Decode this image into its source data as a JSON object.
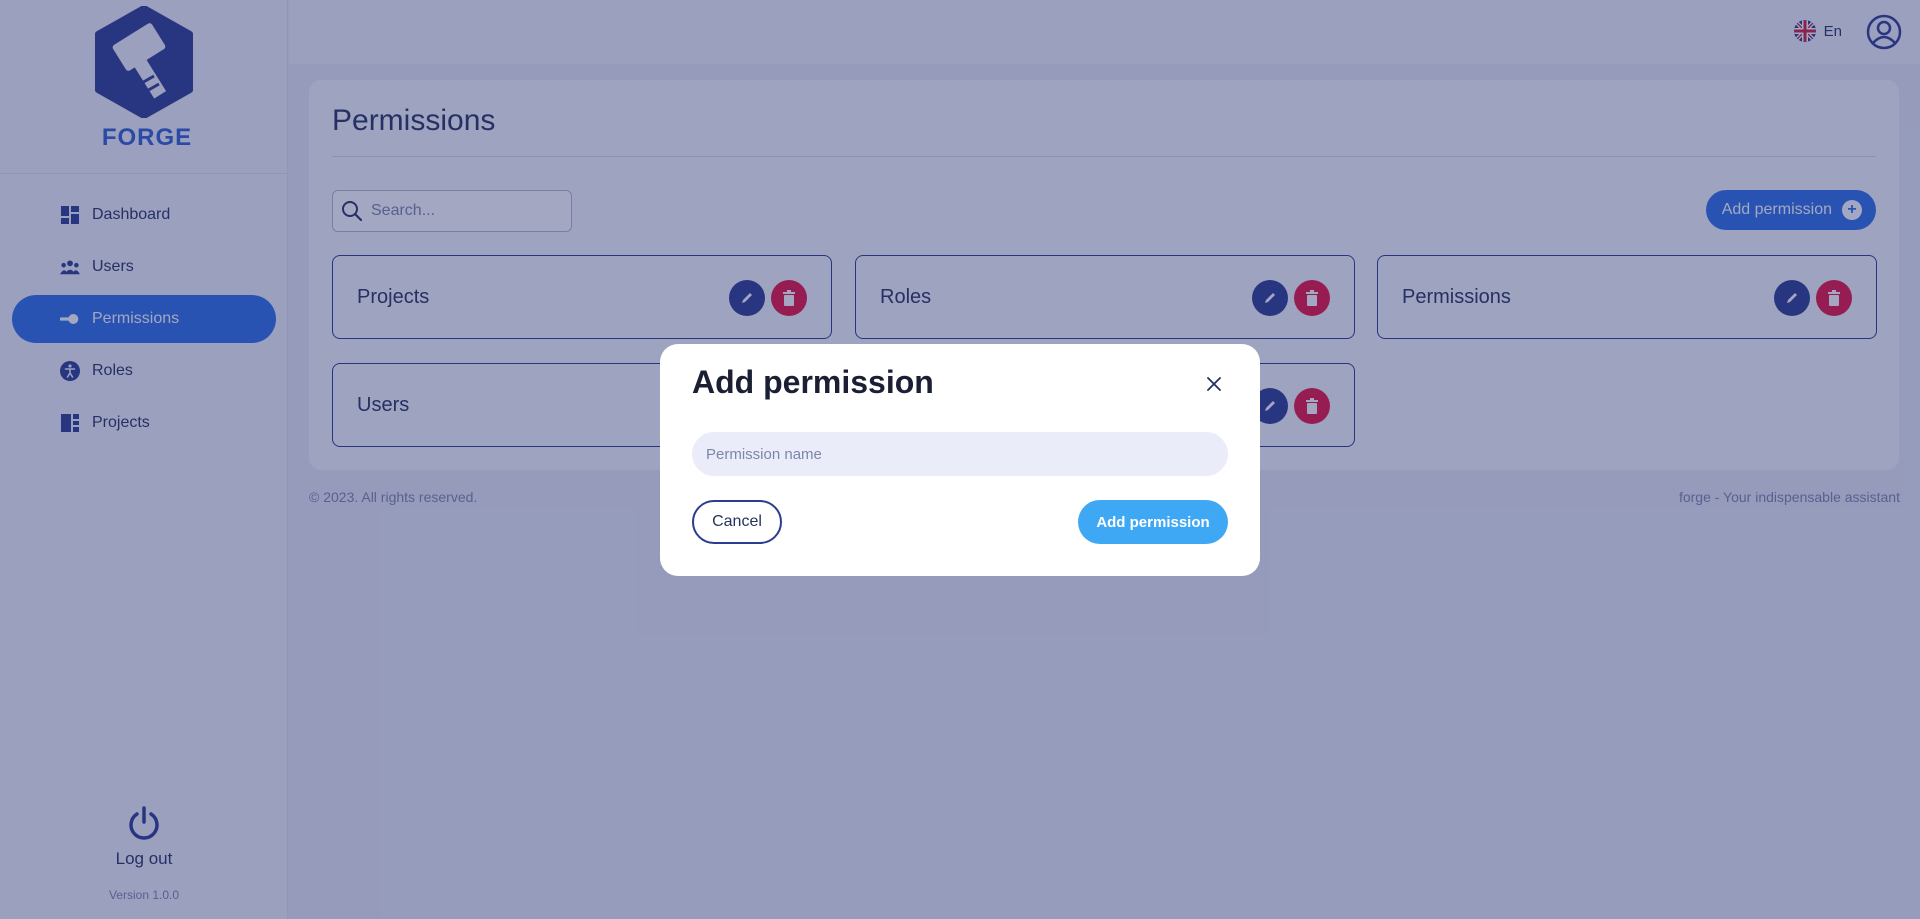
{
  "app": {
    "logo_text": "FORGE",
    "version": "Version 1.0.0",
    "logout_label": "Log out"
  },
  "sidebar": {
    "items": [
      {
        "label": "Dashboard",
        "icon": "dashboard-icon",
        "active": false
      },
      {
        "label": "Users",
        "icon": "users-icon",
        "active": false
      },
      {
        "label": "Permissions",
        "icon": "key-icon",
        "active": true
      },
      {
        "label": "Roles",
        "icon": "accessibility-icon",
        "active": false
      },
      {
        "label": "Projects",
        "icon": "projects-icon",
        "active": false
      }
    ]
  },
  "header": {
    "language": "En",
    "language_icon": "uk-flag-icon",
    "avatar_icon": "user-avatar-icon"
  },
  "main": {
    "title": "Permissions",
    "search": {
      "placeholder": "Search..."
    },
    "add_button_label": "Add permission",
    "permissions": [
      {
        "name": "Projects"
      },
      {
        "name": "Roles"
      },
      {
        "name": "Permissions"
      },
      {
        "name": "Users"
      },
      {
        "name": ""
      }
    ]
  },
  "footer": {
    "copyright": "© 2023. All rights reserved.",
    "tagline": "forge - Your indispensable assistant"
  },
  "modal": {
    "title": "Add permission",
    "input_placeholder": "Permission name",
    "input_value": "",
    "cancel_label": "Cancel",
    "submit_label": "Add permission"
  },
  "colors": {
    "primary": "#2e6ee6",
    "navy": "#2c3c8f",
    "danger": "#e8123f",
    "submit": "#3fa8f5",
    "overlay": "rgba(36,46,108,0.42)"
  }
}
